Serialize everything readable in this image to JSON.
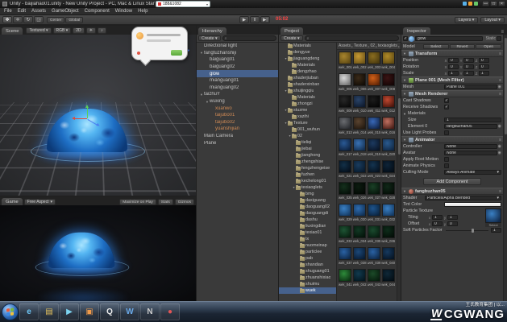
{
  "icons": {
    "check": "✓",
    "caret": "▾",
    "fold_open": "▼",
    "fold_closed": "▶",
    "search": "⌕",
    "menu": "≡",
    "target": "◉",
    "crumb": "▸"
  },
  "window": {
    "title": "Unity - baijiahao01.unity - New Unity Project - PC, Mac & Linux Standalone*",
    "controls": [
      "—",
      "□",
      "×"
    ]
  },
  "titlebar_overlay": {
    "search_text": "188&1082"
  },
  "rec_timer": "05:02",
  "menu": {
    "items": [
      "File",
      "Edit",
      "Assets",
      "GameObject",
      "Component",
      "Window",
      "Help"
    ]
  },
  "toolbar": {
    "tools": [
      {
        "name": "hand-tool",
        "glyph": "✥"
      },
      {
        "name": "move-tool",
        "glyph": "✛"
      },
      {
        "name": "rotate-tool",
        "glyph": "↻"
      },
      {
        "name": "scale-tool",
        "glyph": "◲"
      }
    ],
    "pivot_buttons": [
      "Center",
      "Global"
    ],
    "transport": [
      {
        "name": "play",
        "glyph": "▶"
      },
      {
        "name": "pause",
        "glyph": "‖"
      },
      {
        "name": "step",
        "glyph": "▶|"
      }
    ],
    "dropdowns": [
      {
        "name": "layers",
        "label": "Layers"
      },
      {
        "name": "layout",
        "label": "Layout"
      }
    ]
  },
  "scene": {
    "tab": "Scene",
    "controls": [
      {
        "label": "Textured",
        "caret": true
      },
      {
        "label": "RGB",
        "caret": true
      },
      {
        "label": "2D",
        "caret": false
      },
      {
        "label": "☀",
        "caret": false
      },
      {
        "label": "♪",
        "caret": false
      }
    ]
  },
  "game": {
    "tab": "Game",
    "aspect": "Free Aspect",
    "buttons": [
      "Maximize on Play",
      "Stats",
      "Gizmos"
    ]
  },
  "hierarchy": {
    "tab": "Hierarchy",
    "create_label": "Create",
    "items": [
      {
        "l": "Directional light",
        "i": 0
      },
      {
        "l": "fangtuzhanshiji",
        "i": 0,
        "arr": true
      },
      {
        "l": "baiguang01",
        "i": 1
      },
      {
        "l": "baiguang02",
        "i": 1
      },
      {
        "l": "glow",
        "i": 1,
        "sel": true
      },
      {
        "l": "mianguang01",
        "i": 1
      },
      {
        "l": "mianguang02",
        "i": 1
      },
      {
        "l": "taizhuY",
        "i": 0,
        "arr": true
      },
      {
        "l": "wuxing",
        "i": 1,
        "arr": true
      },
      {
        "l": "xuanwo",
        "i": 2,
        "o": true
      },
      {
        "l": "taijubo01",
        "i": 2,
        "o": true
      },
      {
        "l": "taijubo02",
        "i": 2,
        "o": true
      },
      {
        "l": "yuanshijian",
        "i": 2,
        "o": true
      },
      {
        "l": "Main Camera",
        "i": 0
      },
      {
        "l": "Plane",
        "i": 0
      }
    ]
  },
  "project": {
    "tab": "Project",
    "create_label": "Create",
    "breadcrumb": [
      "Assets",
      "Texture",
      "02",
      "texiaoglets",
      "wuek"
    ],
    "tree": [
      {
        "l": "Materials",
        "i": 1
      },
      {
        "l": "dengyue",
        "i": 1
      },
      {
        "l": "jiaguangdeng",
        "i": 1,
        "arr": true
      },
      {
        "l": "Materials",
        "i": 2
      },
      {
        "l": "dengzhao",
        "i": 2
      },
      {
        "l": "shaderjiuban",
        "i": 1
      },
      {
        "l": "shaderxinban",
        "i": 1
      },
      {
        "l": "shuijingqiu",
        "i": 1,
        "arr": true
      },
      {
        "l": "Materials",
        "i": 2
      },
      {
        "l": "zhongzi",
        "i": 2
      },
      {
        "l": "stuzme",
        "i": 1,
        "arr": true
      },
      {
        "l": "xazihi",
        "i": 2
      },
      {
        "l": "Texture",
        "i": 1,
        "arr": true
      },
      {
        "l": "001_wuhun",
        "i": 2
      },
      {
        "l": "02",
        "i": 2,
        "arr": true
      },
      {
        "l": "tieliqi",
        "i": 3
      },
      {
        "l": "jiebai",
        "i": 3
      },
      {
        "l": "jianghong",
        "i": 3
      },
      {
        "l": "zhengshise",
        "i": 3
      },
      {
        "l": "fengzhengeise",
        "i": 3
      },
      {
        "l": "fuzhen",
        "i": 3
      },
      {
        "l": "kechelong01",
        "i": 3
      },
      {
        "l": "texiaoglets",
        "i": 3,
        "arr": true
      },
      {
        "l": "bmg",
        "i": 4
      },
      {
        "l": "daxiguang",
        "i": 4
      },
      {
        "l": "daoguang02",
        "i": 4
      },
      {
        "l": "daoguangdi",
        "i": 4
      },
      {
        "l": "dashu",
        "i": 4
      },
      {
        "l": "liuxingdian",
        "i": 4
      },
      {
        "l": "texiao01",
        "i": 4
      },
      {
        "l": "tx",
        "i": 4
      },
      {
        "l": "nuomeinap",
        "i": 4
      },
      {
        "l": "particlee",
        "i": 4
      },
      {
        "l": "pab",
        "i": 4
      },
      {
        "l": "shandian",
        "i": 4
      },
      {
        "l": "shuguang01",
        "i": 4
      },
      {
        "l": "zhuanshixiao",
        "i": 4
      },
      {
        "l": "shuimu",
        "i": 4
      },
      {
        "l": "wuek",
        "i": 4,
        "sel": true
      }
    ],
    "tiles": [
      {
        "l": "wek_001",
        "c": [
          "#a8852e",
          "#5f4a14"
        ]
      },
      {
        "l": "wek_002",
        "c": [
          "#c79a33",
          "#6e5518"
        ]
      },
      {
        "l": "wek_003",
        "c": [
          "#8a6d20",
          "#4a3a0e"
        ]
      },
      {
        "l": "wek_004",
        "c": [
          "#b08a28",
          "#614b12"
        ]
      },
      {
        "l": "wek_005",
        "c": [
          "#d8d8d8",
          "#707070"
        ]
      },
      {
        "l": "wek_006",
        "c": [
          "#3a2a18",
          "#120c06"
        ]
      },
      {
        "l": "wek_007",
        "c": [
          "#d06018",
          "#5f2406"
        ]
      },
      {
        "l": "wek_008",
        "c": [
          "#3a1414",
          "#140505"
        ]
      },
      {
        "l": "wek_009",
        "c": [
          "#282828",
          "#0a0a0a"
        ]
      },
      {
        "l": "wek_010",
        "c": [
          "#2a4468",
          "#0e1a2e"
        ]
      },
      {
        "l": "wek_011",
        "c": [
          "#1c1c1c",
          "#060606"
        ]
      },
      {
        "l": "wek_012",
        "c": [
          "#c04830",
          "#4a150c"
        ]
      },
      {
        "l": "wek_013",
        "c": [
          "#6a6c70",
          "#2a2c30"
        ]
      },
      {
        "l": "wek_014",
        "c": [
          "#5a4430",
          "#241a10"
        ]
      },
      {
        "l": "wek_015",
        "c": [
          "#3868b8",
          "#122548"
        ]
      },
      {
        "l": "wek_016",
        "c": [
          "#c07060",
          "#4a1f18"
        ]
      },
      {
        "l": "wek_017",
        "c": [
          "#2a5a96",
          "#0e2240"
        ]
      },
      {
        "l": "wek_018",
        "c": [
          "#3a72b4",
          "#143052"
        ]
      },
      {
        "l": "wek_019",
        "c": [
          "#1c3a60",
          "#0a1628"
        ]
      },
      {
        "l": "wek_020",
        "c": [
          "#2a5a8e",
          "#102844"
        ]
      },
      {
        "l": "wek_021",
        "c": [
          "#123048",
          "#050f1a"
        ]
      },
      {
        "l": "wek_022",
        "c": [
          "#1a3c5e",
          "#081a2c"
        ]
      },
      {
        "l": "wek_023",
        "c": [
          "#143450",
          "#06121f"
        ]
      },
      {
        "l": "wek_024",
        "c": [
          "#0e2438",
          "#040d16"
        ]
      },
      {
        "l": "wek_025",
        "c": [
          "#14301c",
          "#050f08"
        ]
      },
      {
        "l": "wek_026",
        "c": [
          "#0c1c10",
          "#030804"
        ]
      },
      {
        "l": "wek_027",
        "c": [
          "#1a4026",
          "#07160c"
        ]
      },
      {
        "l": "wek_028",
        "c": [
          "#102818",
          "#040c06"
        ]
      },
      {
        "l": "wek_029",
        "c": [
          "#3a80c4",
          "#143a64"
        ]
      },
      {
        "l": "wek_030",
        "c": [
          "#2e6cb0",
          "#103054"
        ]
      },
      {
        "l": "wek_031",
        "c": [
          "#1e548c",
          "#0a2440"
        ]
      },
      {
        "l": "wek_032",
        "c": [
          "#3a80c4",
          "#143a64"
        ]
      },
      {
        "l": "wek_033",
        "c": [
          "#1e5434",
          "#081f10"
        ]
      },
      {
        "l": "wek_034",
        "c": [
          "#123824",
          "#04140a"
        ]
      },
      {
        "l": "wek_035",
        "c": [
          "#1a4a2e",
          "#071d10"
        ]
      },
      {
        "l": "wek_036",
        "c": [
          "#0e2c1a",
          "#030e07"
        ]
      },
      {
        "l": "wek_037",
        "c": [
          "#2a62a4",
          "#0e2848"
        ]
      },
      {
        "l": "wek_038",
        "c": [
          "#1c4878",
          "#081c34"
        ]
      },
      {
        "l": "wek_039",
        "c": [
          "#2a62a4",
          "#0e2848"
        ]
      },
      {
        "l": "wek_040",
        "c": [
          "#16395e",
          "#061525"
        ]
      },
      {
        "l": "wek_041",
        "c": [
          "#2e8b3a",
          "#0d3314"
        ]
      },
      {
        "l": "wek_042",
        "c": [
          "#123a4e",
          "#041720"
        ]
      },
      {
        "l": "wek_043",
        "c": [
          "#1c4a28",
          "#071d0e"
        ]
      },
      {
        "l": "wek_044",
        "c": [
          "#0f2838",
          "#030d14"
        ]
      }
    ]
  },
  "inspector": {
    "tab": "Inspector",
    "name": "glow",
    "static_label": "Static",
    "prefab": {
      "label": "Model",
      "buttons": [
        "Select",
        "Revert",
        "Open"
      ]
    },
    "transform": {
      "title": "Transform",
      "rows": [
        {
          "label": "Position",
          "x": "0",
          "y": "0",
          "z": "0"
        },
        {
          "label": "Rotation",
          "x": "0",
          "y": "0",
          "z": "0"
        },
        {
          "label": "Scale",
          "x": "1",
          "y": "1",
          "z": "1"
        }
      ]
    },
    "mesh_filter": {
      "title": "Plane 001 (Mesh Filter)",
      "mesh_label": "Mesh",
      "mesh_value": "Plane 001"
    },
    "mesh_renderer": {
      "title": "Mesh Renderer",
      "cast_label": "Cast Shadows",
      "receive_label": "Receive Shadows",
      "materials_label": "Materials",
      "size_label": "Size",
      "size_value": "1",
      "element_label": "Element 0",
      "element_value": "fangbuzhan05",
      "probes_label": "Use Light Probes"
    },
    "animator": {
      "title": "Animator",
      "controller_label": "Controller",
      "controller_value": "None",
      "avatar_label": "Avatar",
      "avatar_value": "None",
      "root_motion_label": "Apply Root Motion",
      "physics_label": "Animate Physics",
      "culling_label": "Culling Mode",
      "culling_value": "Always Animate"
    },
    "add_component_label": "Add Component",
    "material": {
      "name": "fangbuzhan05",
      "shader_label": "Shader",
      "shader_value": "Particles/Alpha Blended",
      "tint_label": "Tint Color",
      "texture_label": "Particle Texture",
      "tiling_label": "Tiling",
      "offset_label": "Offset",
      "tiling_x": "1",
      "tiling_y": "1",
      "offset_x": "0",
      "offset_y": "0",
      "soft_label": "Soft Particles Factor",
      "soft_value": "1",
      "select_label": "Select"
    }
  },
  "taskbar": {
    "orb_colors": [
      "#e85a3a",
      "#7ab83a",
      "#3a8ae8",
      "#f0c23a"
    ],
    "icons": [
      {
        "name": "internet-explorer",
        "glyph": "e",
        "color": "#6ec6f5"
      },
      {
        "name": "file-explorer",
        "glyph": "▤",
        "color": "#e8c35c"
      },
      {
        "name": "media-player",
        "glyph": "▶",
        "color": "#7dd4f0"
      },
      {
        "name": "image-viewer",
        "glyph": "▣",
        "color": "#f09a4a"
      },
      {
        "name": "qq",
        "glyph": "Q",
        "color": "#eeeeee"
      },
      {
        "name": "word",
        "glyph": "W",
        "color": "#6aa9e8"
      },
      {
        "name": "notepad",
        "glyph": "N",
        "color": "#cccccc"
      },
      {
        "name": "recorder",
        "glyph": "●",
        "color": "#e25555"
      }
    ]
  },
  "tray": [
    {
      "color": "#57b0e8"
    },
    {
      "color": "#f0a030"
    },
    {
      "color": "#68c868"
    }
  ],
  "watermark": {
    "line": "王氏教育集团 | 以...",
    "brand": "CGWANG",
    "logo": "W"
  }
}
